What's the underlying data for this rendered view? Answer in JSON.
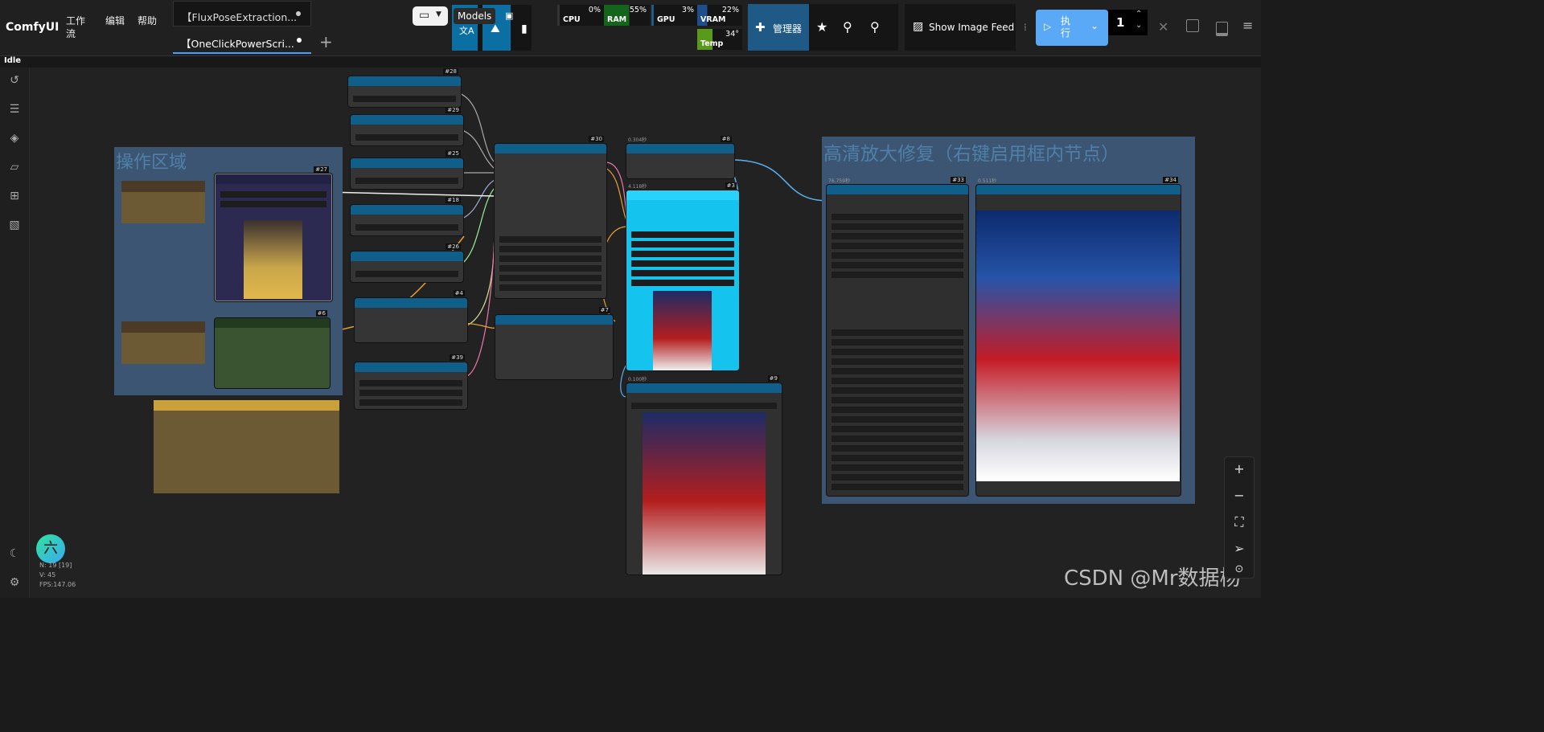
{
  "app": {
    "logo": "ComfyUI",
    "status": "Idle"
  },
  "menu": {
    "workflow": "工作流",
    "edit": "编辑",
    "help": "帮助"
  },
  "tabs": [
    {
      "label": "【FluxPoseExtraction..."
    },
    {
      "label": "【OneClickPowerScri..."
    }
  ],
  "toolbar": {
    "models_label": "Models",
    "manager_label": "管理器",
    "image_feed_label": "Show Image Feed",
    "run_label": "执行",
    "queue_count": "1"
  },
  "stats": {
    "cpu": {
      "label": "CPU",
      "value": "0%"
    },
    "ram": {
      "label": "RAM",
      "value": "55%"
    },
    "gpu": {
      "label": "GPU",
      "value": "3%"
    },
    "vram": {
      "label": "VRAM",
      "value": "22%"
    },
    "temp": {
      "label": "Temp",
      "value": "34°"
    }
  },
  "canvas": {
    "group_operation": "操作区域",
    "group_upscale": "高清放大修复（右键启用框内节点）",
    "node_ids": [
      "#28",
      "#29",
      "#25",
      "#18",
      "#26",
      "#4",
      "#39",
      "#30",
      "#7",
      "#8",
      "#3",
      "#9",
      "#27",
      "#6",
      "#33",
      "#34"
    ],
    "timings": {
      "n8": "0.304秒",
      "n3": "4.118秒",
      "n9": "0.100秒",
      "n33": "76.759秒",
      "n34": "0.511秒"
    }
  },
  "bottom_info": {
    "avatar_char": "六",
    "nodes": "N: 19 [19]",
    "vertices": "V: 45",
    "fps": "FPS:147.06"
  },
  "watermark": "CSDN @Mr数据杨",
  "colors": {
    "accent": "#4a9eff",
    "header": "#0f5f8a",
    "run": "#5aa9f7"
  }
}
